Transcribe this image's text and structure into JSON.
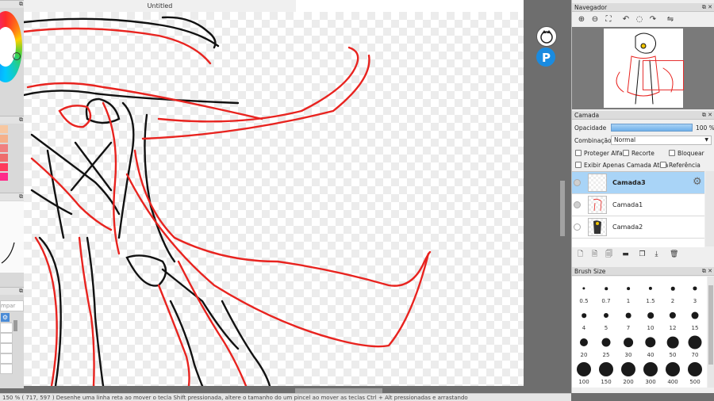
{
  "canvas": {
    "title": "Untitled"
  },
  "left_panel": {
    "swatches": [
      "#f7c7a1",
      "#f5b08a",
      "#f08080",
      "#ee6d6d",
      "#ff3a5c",
      "#ff2a8a"
    ],
    "input_placeholder": "mpar"
  },
  "navigator": {
    "title": "Navegador",
    "tools": [
      "zoom-in-icon",
      "zoom-out-icon",
      "fit-view-icon",
      "rotate-left-icon",
      "reset-rotation-icon",
      "rotate-right-icon",
      "flip-icon"
    ]
  },
  "layer_panel": {
    "title": "Camada",
    "opacity_label": "Opacidade",
    "opacity_value": "100 %",
    "opacity_level": 1.0,
    "blend_label": "Combinação",
    "blend_value": "Normal",
    "options": {
      "protect_alpha": "Proteger Alfa",
      "clip": "Recorte",
      "lock": "Bloquear",
      "show_active_only": "Exibir Apenas Camada Ativa",
      "reference": "Referência"
    },
    "layers": [
      {
        "name": "Camada3",
        "selected": true
      },
      {
        "name": "Camada1",
        "selected": false
      },
      {
        "name": "Camada2",
        "selected": false
      }
    ],
    "tools": [
      "new-layer-icon",
      "new-raster-layer-icon",
      "new-halftone-layer-icon",
      "new-folder-icon",
      "duplicate-layer-icon",
      "merge-down-icon",
      "delete-layer-icon"
    ]
  },
  "brush_size": {
    "title": "Brush Size",
    "sizes": [
      "0.5",
      "0.7",
      "1",
      "1.5",
      "2",
      "3",
      "4",
      "5",
      "7",
      "10",
      "12",
      "15",
      "20",
      "25",
      "30",
      "40",
      "50",
      "70",
      "100",
      "150",
      "200",
      "300",
      "400",
      "500"
    ]
  },
  "status_bar": {
    "text": "150 %  ( 717, 597 )   Desenhe uma linha reta ao mover o tecla Shift pressionada, altere o tamanho do um pincel ao mover as teclas Ctrl + Alt pressionadas e arrastando"
  },
  "colors": {
    "accent": "#a9d4f7",
    "line_art_red": "#e8231f",
    "line_art_black": "#111111"
  }
}
